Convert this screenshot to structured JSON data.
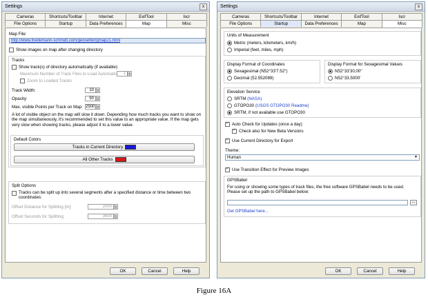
{
  "left": {
    "title": "Settings",
    "close_glyph": "x",
    "tabs_row1": [
      "Cameras",
      "Shortcuts/Toolbar",
      "Internet",
      "ExifTool",
      "Iscr"
    ],
    "tabs_row2": [
      "File Options",
      "Startup",
      "Data Preferences",
      "Map",
      "Misc"
    ],
    "active_tab": "Map",
    "map_file_label": "Map File:",
    "map_file_value": "http://www.friedemann-schmidt.com/geosetter/gmap21.html",
    "show_images_label": "Show images on map after changing directory",
    "tracks": {
      "title": "Tracks",
      "show_tracks_label": "Show track(s) of directory automatically (if available)",
      "max_tracks_label": "Maximum Number of Track Files to Load Automatically:",
      "max_tracks_value": "1",
      "zoom_label": "Zoom to Loaded Tracks",
      "width_label": "Track Width:",
      "width_value": "10",
      "opacity_label": "Opacity:",
      "opacity_value": "50",
      "max_points_label": "Max. visible Points per Track on Map:",
      "max_points_value": "2500",
      "info_text": "A lot of visible object on the map will slow it down. Depending how much tracks you want to show on the map simultaneously, it's recommended to set this value to an appropriate value. If the map gets very slow when showing tracks, please adjust it to a lower value."
    },
    "colors": {
      "title": "Default Colors",
      "current_dir_label": "Tracks in Current Directory",
      "current_dir_color": "#1a1ad6",
      "other_label": "All Other Tracks",
      "other_color": "#d81818"
    },
    "split": {
      "title": "Split Options",
      "split_label": "Tracks can be split up into several segments after a specified distance or time between two coordinates:",
      "distance_label": "Offset Distance for Splitting [m]:",
      "distance_value": "2000",
      "seconds_label": "Offset Seconds for Splitting:",
      "seconds_value": "3600"
    },
    "buttons": {
      "ok": "OK",
      "cancel": "Cancel",
      "help": "Help"
    }
  },
  "right": {
    "title": "Settings",
    "close_glyph": "x",
    "tabs_row1": [
      "Cameras",
      "Shortcuts/Toolbar",
      "Internet",
      "ExifTool",
      "Iscr"
    ],
    "tabs_row2": [
      "File Options",
      "Startup",
      "Data Preferences",
      "Map",
      "Misc"
    ],
    "active_tab": "Misc",
    "units": {
      "title": "Units of Measurement",
      "metric": "Metric (meters, kilometers, km/h)",
      "imperial": "Imperial (feet, miles, mph)"
    },
    "coord_format": {
      "title": "Display Format of Coordinates",
      "sexagesimal": "Sexagesimal (N52°33'7.52\")",
      "decimal": "Decimal (52.552089)"
    },
    "sexa_format": {
      "title": "Display Format for Sexagesimal Values",
      "opt1": "N52°33'30,00\"",
      "opt2": "N52°33.5000'"
    },
    "elevation": {
      "title": "Elevation Service",
      "srtm": "SRTM",
      "srtm_link": "(NASA)",
      "gtopo": "GTOPO30",
      "gtopo_link": "(USGS GTOPO30 Readme)",
      "srtm_fallback": "SRTM, if not available use GTOPO30"
    },
    "auto_check_label": "Auto Check for Updates (once a day)",
    "beta_label": "Check also for New Beta Versions",
    "current_dir_export_label": "Use Current Directory for Export",
    "theme_label": "Theme:",
    "theme_value": "Human",
    "transition_label": "Use Transition Effect for Preview Images",
    "gpsbabel": {
      "title": "GPSBabel",
      "info": "For using or showing some types of track files, the free software GPSBabel needs to be used. Please set up the path to GPSBabel below:",
      "path_value": "",
      "browse_label": "...",
      "link": "Get GPSBabel here..."
    },
    "buttons": {
      "ok": "OK",
      "cancel": "Cancel",
      "help": "Help"
    }
  },
  "caption": "Figure 16A"
}
